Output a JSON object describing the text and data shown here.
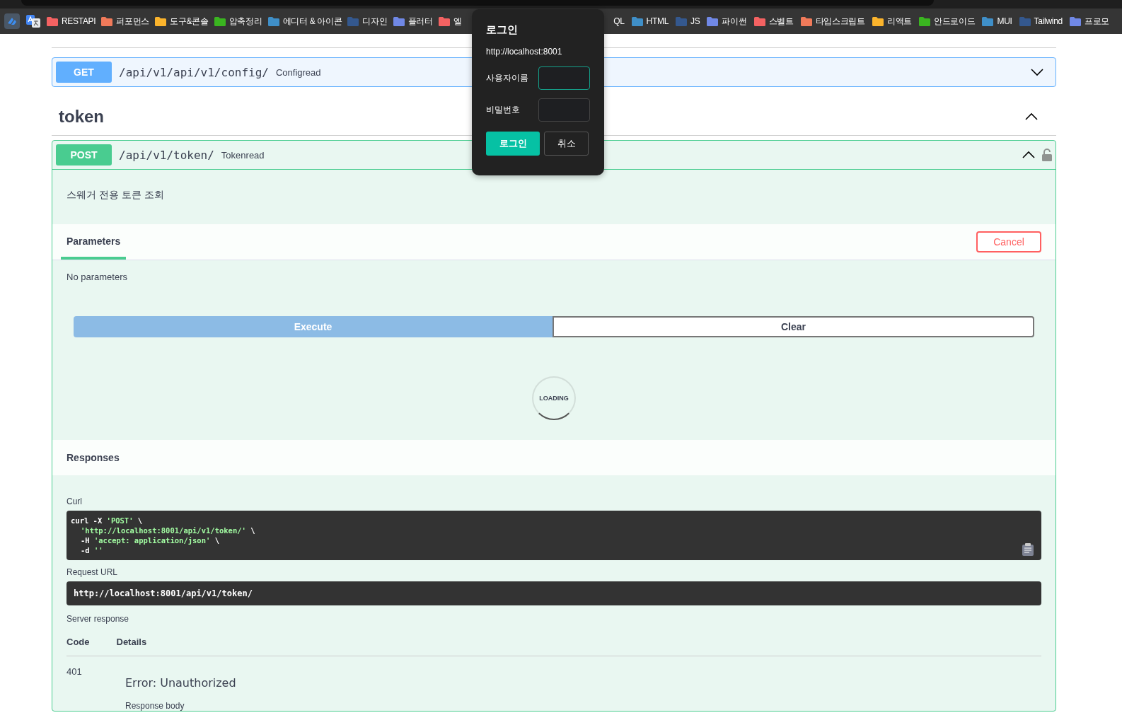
{
  "browser": {
    "bookmarks": [
      {
        "label": "RESTAPI",
        "color": "#f46262"
      },
      {
        "label": "퍼포먼스",
        "color": "#f07a5a"
      },
      {
        "label": "도구&콘솔",
        "color": "#fbb42c"
      },
      {
        "label": "압축정리",
        "color": "#3ab520"
      },
      {
        "label": "에디터 & 아이콘",
        "color": "#3f8fc8"
      },
      {
        "label": "디자인",
        "color": "#34588e"
      },
      {
        "label": "플러터",
        "color": "#7088e6"
      },
      {
        "label": "엘",
        "color": "#f46262"
      },
      {
        "label": "QL"
      },
      {
        "label": "HTML",
        "color": "#3f8fc8"
      },
      {
        "label": "JS",
        "color": "#34588e"
      },
      {
        "label": "파이썬",
        "color": "#7088e6"
      },
      {
        "label": "스벨트",
        "color": "#f46262"
      },
      {
        "label": "타입스크립트",
        "color": "#f07a5a"
      },
      {
        "label": "리액트",
        "color": "#fbb42c"
      },
      {
        "label": "안드로이드",
        "color": "#3ab520"
      },
      {
        "label": "MUI",
        "color": "#3f8fc8"
      },
      {
        "label": "Tailwind",
        "color": "#34588e"
      },
      {
        "label": "프로모",
        "color": "#7088e6"
      }
    ]
  },
  "get_operation": {
    "method": "GET",
    "kind": "get",
    "path": "/api/v1/api/v1/config/",
    "summary": "Configread",
    "expanded": false
  },
  "tag": {
    "name": "token",
    "expanded": true
  },
  "post_operation": {
    "method": "POST",
    "kind": "post",
    "path": "/api/v1/token/",
    "summary": "Tokenread",
    "expanded": true,
    "locked": false,
    "description": "스웨거 전용 토큰 조회",
    "tabs": [
      {
        "label": "Parameters",
        "selected": true
      }
    ],
    "cancel": "Cancel",
    "no_params": "No parameters",
    "execute": {
      "label": "Execute",
      "disabled": true
    },
    "clear": "Clear",
    "loading": "LOADING",
    "responses_title": "Responses",
    "curl_label": "Curl",
    "curl_lines": [
      {
        "indent": false,
        "parts": [
          {
            "text": "curl -X ",
            "kind": "plain"
          },
          {
            "text": "'POST'",
            "kind": "string"
          },
          {
            "text": " \\",
            "kind": "plain"
          }
        ]
      },
      {
        "indent": true,
        "parts": [
          {
            "text": "'http://localhost:8001/api/v1/token/'",
            "kind": "string"
          },
          {
            "text": " \\",
            "kind": "plain"
          }
        ]
      },
      {
        "indent": true,
        "parts": [
          {
            "text": "-H ",
            "kind": "plain"
          },
          {
            "text": "'accept: application/json'",
            "kind": "string"
          },
          {
            "text": " \\",
            "kind": "plain"
          }
        ]
      },
      {
        "indent": true,
        "parts": [
          {
            "text": "-d ",
            "kind": "plain"
          },
          {
            "text": "''",
            "kind": "string"
          }
        ]
      }
    ],
    "request_url_label": "Request URL",
    "request_url": "http://localhost:8001/api/v1/token/",
    "server_response_label": "Server response",
    "columns": [
      "Code",
      "Details"
    ],
    "response": {
      "code": "401",
      "error": "Error: Unauthorized",
      "body_label": "Response body"
    }
  },
  "login_dialog": {
    "title": "로그인",
    "url": "http://localhost:8001",
    "fields": [
      {
        "label": "사용자이름",
        "focused": true
      },
      {
        "label": "비밀번호",
        "focused": false
      }
    ],
    "submit": "로그인",
    "cancel": "취소"
  }
}
